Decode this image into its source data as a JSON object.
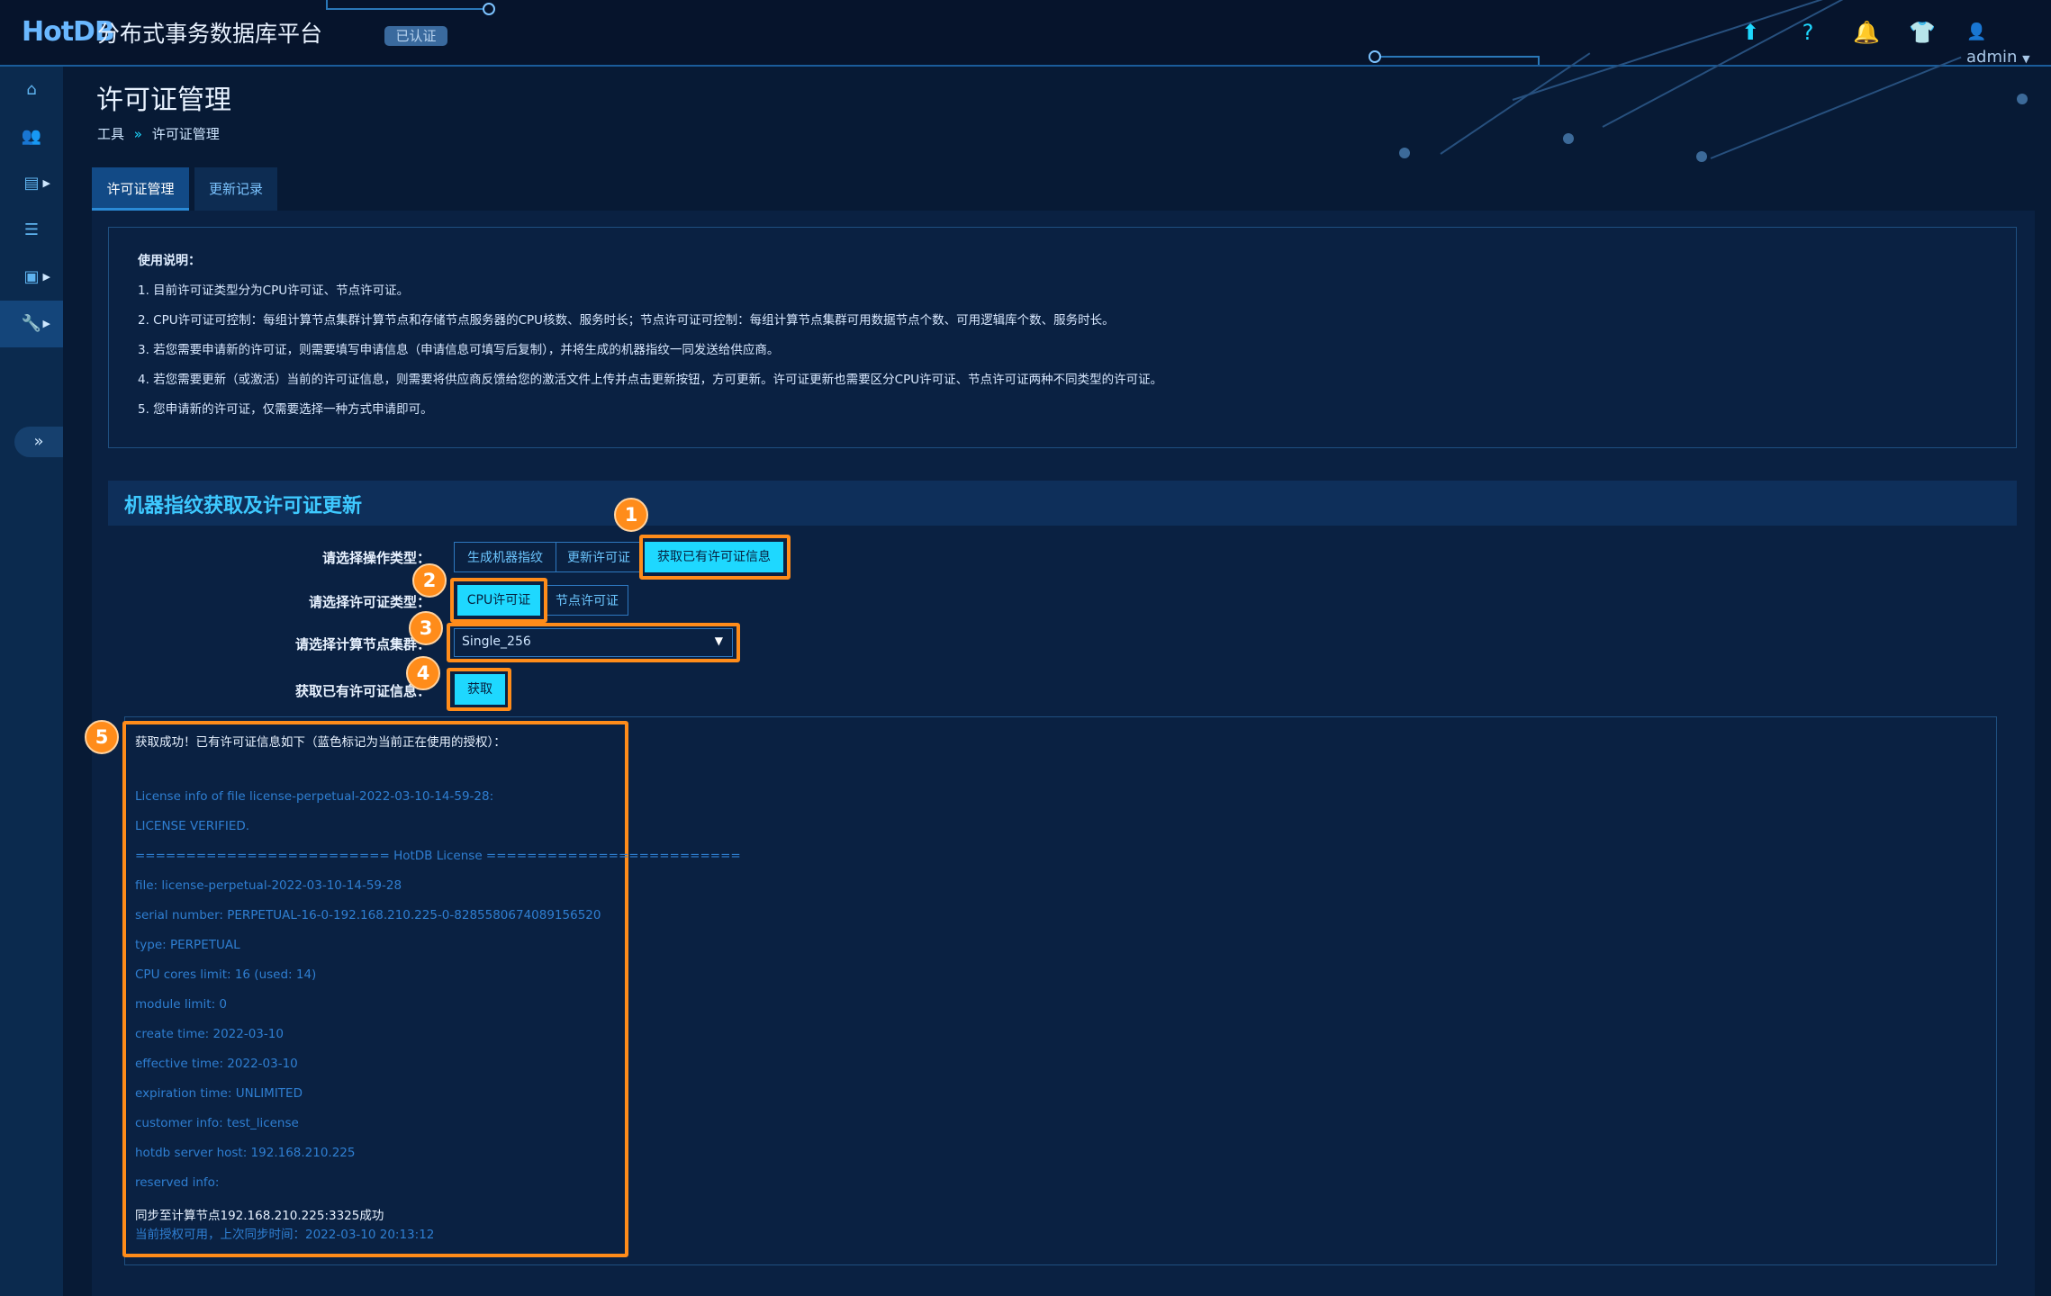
{
  "header": {
    "logo": "HotDB",
    "title": "分布式事务数据库平台",
    "cert_badge": "已认证",
    "icons": [
      "upload-icon",
      "help-icon",
      "bell-icon",
      "shirt-icon"
    ],
    "user": "admin"
  },
  "sidebar": {
    "items": [
      {
        "icon": "home-icon",
        "glyph": "⌂"
      },
      {
        "icon": "users-icon",
        "glyph": "👥"
      },
      {
        "icon": "server-icon",
        "glyph": "▤"
      },
      {
        "icon": "database-icon",
        "glyph": "☰"
      },
      {
        "icon": "save-icon",
        "glyph": "▣"
      },
      {
        "icon": "wrench-icon",
        "glyph": "🔧"
      }
    ],
    "collapse_glyph": "»"
  },
  "page": {
    "title": "许可证管理",
    "breadcrumb": [
      "工具",
      "许可证管理"
    ],
    "breadcrumb_sep": "»"
  },
  "tabs": [
    {
      "label": "许可证管理",
      "active": true
    },
    {
      "label": "更新记录",
      "active": false
    }
  ],
  "instructions": {
    "title": "使用说明：",
    "lines": [
      "1. 目前许可证类型分为CPU许可证、节点许可证。",
      "2. CPU许可证可控制：每组计算节点集群计算节点和存储节点服务器的CPU核数、服务时长；节点许可证可控制：每组计算节点集群可用数据节点个数、可用逻辑库个数、服务时长。",
      "3. 若您需要申请新的许可证，则需要填写申请信息（申请信息可填写后复制），并将生成的机器指纹一同发送给供应商。",
      "4. 若您需要更新（或激活）当前的许可证信息，则需要将供应商反馈给您的激活文件上传并点击更新按钮，方可更新。许可证更新也需要区分CPU许可证、节点许可证两种不同类型的许可证。",
      "5. 您申请新的许可证，仅需要选择一种方式申请即可。"
    ]
  },
  "section": {
    "title": "机器指纹获取及许可证更新"
  },
  "form": {
    "op_label": "请选择操作类型：",
    "op_options": [
      "生成机器指纹",
      "更新许可证",
      "获取已有许可证信息"
    ],
    "op_selected": "获取已有许可证信息",
    "license_label": "请选择许可证类型：",
    "license_options": [
      "CPU许可证",
      "节点许可证"
    ],
    "license_selected": "CPU许可证",
    "cluster_label": "请选择计算节点集群：",
    "cluster_value": "Single_256",
    "fetch_label": "获取已有许可证信息：",
    "fetch_button": "获取"
  },
  "badges": [
    "1",
    "2",
    "3",
    "4",
    "5"
  ],
  "result": {
    "lines": [
      {
        "text": "获取成功！已有许可证信息如下（蓝色标记为当前正在使用的授权）：",
        "color": "white"
      },
      {
        "text": "",
        "color": "blue"
      },
      {
        "text": "License info of file license-perpetual-2022-03-10-14-59-28:",
        "color": "blue"
      },
      {
        "text": "LICENSE VERIFIED.",
        "color": "blue"
      },
      {
        "text": "========================= HotDB License =========================",
        "color": "blue"
      },
      {
        "text": "file: license-perpetual-2022-03-10-14-59-28",
        "color": "blue"
      },
      {
        "text": "serial number: PERPETUAL-16-0-192.168.210.225-0-8285580674089156520",
        "color": "blue"
      },
      {
        "text": "type: PERPETUAL",
        "color": "blue"
      },
      {
        "text": "CPU cores limit: 16 (used: 14)",
        "color": "blue"
      },
      {
        "text": "module limit: 0",
        "color": "blue"
      },
      {
        "text": "create time: 2022-03-10",
        "color": "blue"
      },
      {
        "text": "effective time: 2022-03-10",
        "color": "blue"
      },
      {
        "text": "expiration time: UNLIMITED",
        "color": "blue"
      },
      {
        "text": "customer info: test_license",
        "color": "blue"
      },
      {
        "text": "hotdb server host: 192.168.210.225",
        "color": "blue"
      },
      {
        "text": "reserved info:",
        "color": "blue"
      },
      {
        "text": "同步至计算节点192.168.210.225:3325成功",
        "color": "white"
      },
      {
        "text": "当前授权可用，上次同步时间：2022-03-10 20:13:12",
        "color": "blue"
      }
    ]
  }
}
